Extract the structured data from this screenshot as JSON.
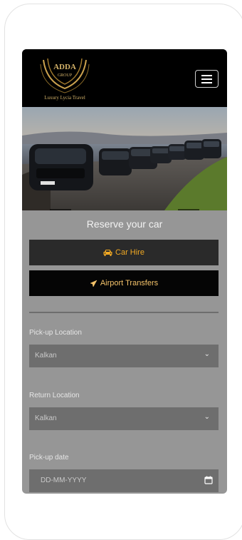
{
  "logo": {
    "brand": "ADDA",
    "sub": "GROUP",
    "tagline": "Luxury Lycia Travel"
  },
  "hero": {
    "prev_arrow": "←",
    "next_arrow": "→"
  },
  "form": {
    "title": "Reserve your car",
    "car_hire_label": "Car Hire",
    "airport_label": "Airport Transfers",
    "pickup_location_label": "Pick-up Location",
    "pickup_location_value": "Kalkan",
    "return_location_label": "Return Location",
    "return_location_value": "Kalkan",
    "pickup_date_label": "Pick-up date",
    "pickup_date_placeholder": "DD-MM-YYYY"
  },
  "colors": {
    "accent": "#f0a823",
    "form_bg": "#969696",
    "field_bg": "#6e6e6e",
    "header_bg": "#000000"
  },
  "icons": [
    "menu-icon",
    "car-icon",
    "plane-icon",
    "chevron-down-icon",
    "calendar-icon"
  ]
}
